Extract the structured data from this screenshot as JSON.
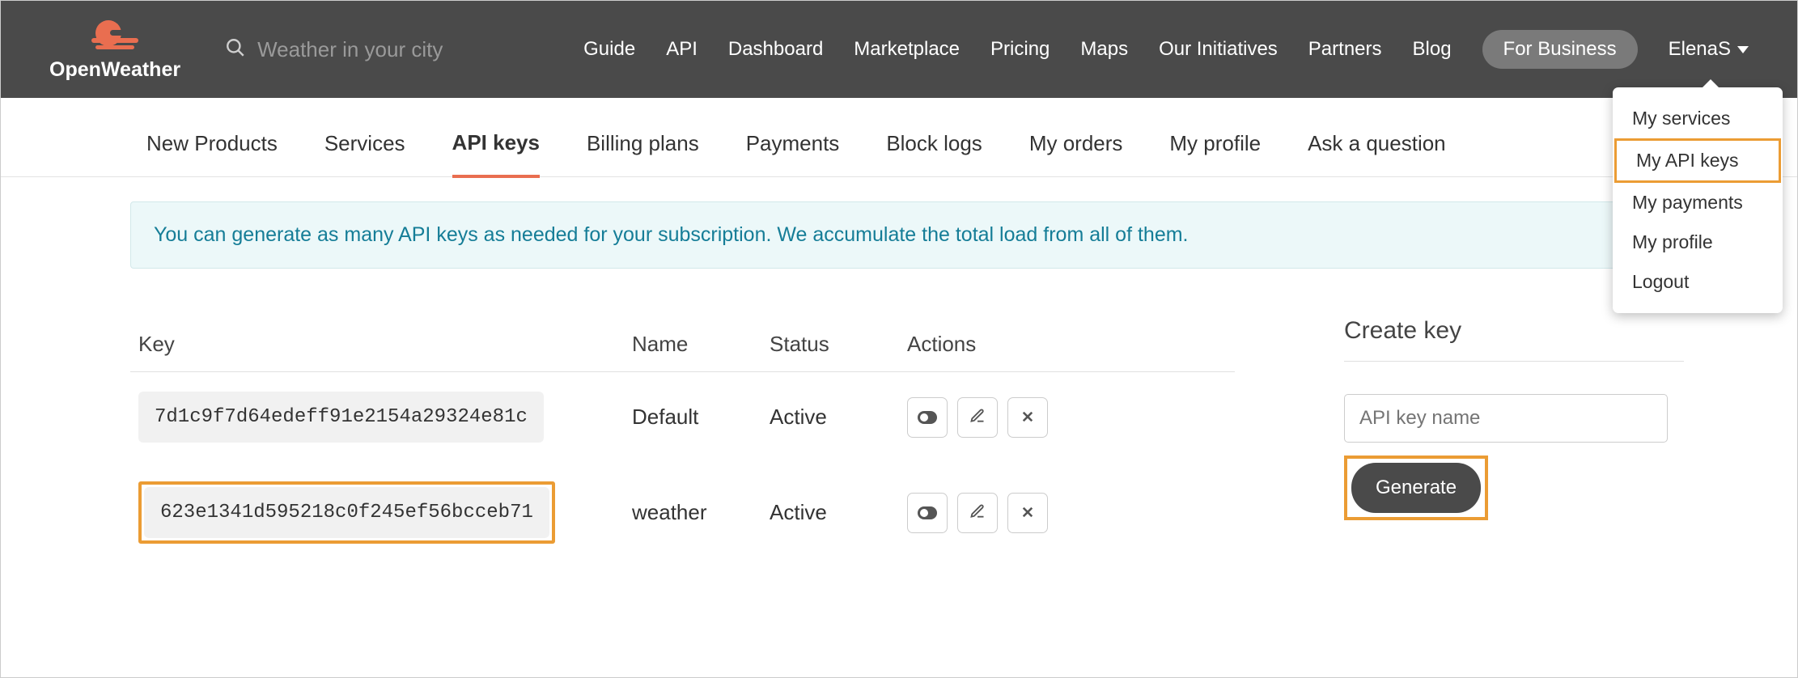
{
  "brand": {
    "name": "OpenWeather"
  },
  "search": {
    "placeholder": "Weather in your city"
  },
  "nav": {
    "items": [
      "Guide",
      "API",
      "Dashboard",
      "Marketplace",
      "Pricing",
      "Maps",
      "Our Initiatives",
      "Partners",
      "Blog"
    ],
    "business": "For Business",
    "user": "ElenaS"
  },
  "dropdown": {
    "items": [
      "My services",
      "My API keys",
      "My payments",
      "My profile",
      "Logout"
    ],
    "highlight_index": 1
  },
  "tabs": {
    "items": [
      "New Products",
      "Services",
      "API keys",
      "Billing plans",
      "Payments",
      "Block logs",
      "My orders",
      "My profile",
      "Ask a question"
    ],
    "active_index": 2
  },
  "banner": "You can generate as many API keys as needed for your subscription. We accumulate the total load from all of them.",
  "table": {
    "headers": {
      "key": "Key",
      "name": "Name",
      "status": "Status",
      "actions": "Actions"
    },
    "rows": [
      {
        "key": "7d1c9f7d64edeff91e2154a29324e81c",
        "name": "Default",
        "status": "Active"
      },
      {
        "key": "623e1341d595218c0f245ef56bcceb71",
        "name": "weather",
        "status": "Active"
      }
    ],
    "highlight_row_index": 1
  },
  "create": {
    "title": "Create key",
    "input_placeholder": "API key name",
    "button": "Generate"
  }
}
